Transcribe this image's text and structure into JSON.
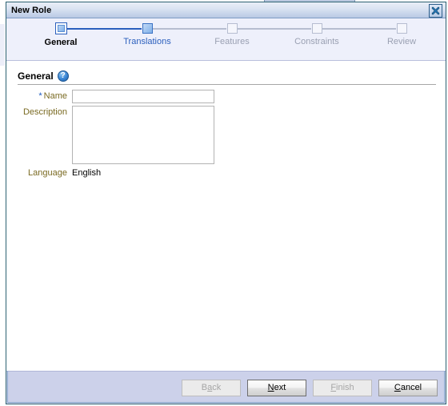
{
  "window": {
    "title": "New Role",
    "close_icon": "close-icon"
  },
  "train": {
    "steps": [
      {
        "label": "General",
        "state": "current"
      },
      {
        "label": "Translations",
        "state": "active"
      },
      {
        "label": "Features",
        "state": "inactive"
      },
      {
        "label": "Constraints",
        "state": "inactive"
      },
      {
        "label": "Review",
        "state": "inactive"
      }
    ],
    "colors": {
      "done_line": "#2b5fbd",
      "todo_line": "#b6bdd0",
      "active_text": "#2b5fbd",
      "inactive_text": "#9aa0b2"
    }
  },
  "section": {
    "title": "General",
    "help_icon": "?",
    "help_icon_name": "help-icon"
  },
  "form": {
    "name": {
      "label": "Name",
      "required_marker": "*",
      "value": "",
      "placeholder": ""
    },
    "description": {
      "label": "Description",
      "value": "",
      "placeholder": ""
    },
    "language": {
      "label": "Language",
      "value": "English"
    }
  },
  "buttons": {
    "back": {
      "pre": "B",
      "mn": "a",
      "post": "ck",
      "enabled": false
    },
    "next": {
      "pre": "",
      "mn": "N",
      "post": "ext",
      "enabled": true
    },
    "finish": {
      "pre": "",
      "mn": "F",
      "post": "inish",
      "enabled": false
    },
    "cancel": {
      "pre": "",
      "mn": "C",
      "post": "ancel",
      "enabled": true
    }
  }
}
